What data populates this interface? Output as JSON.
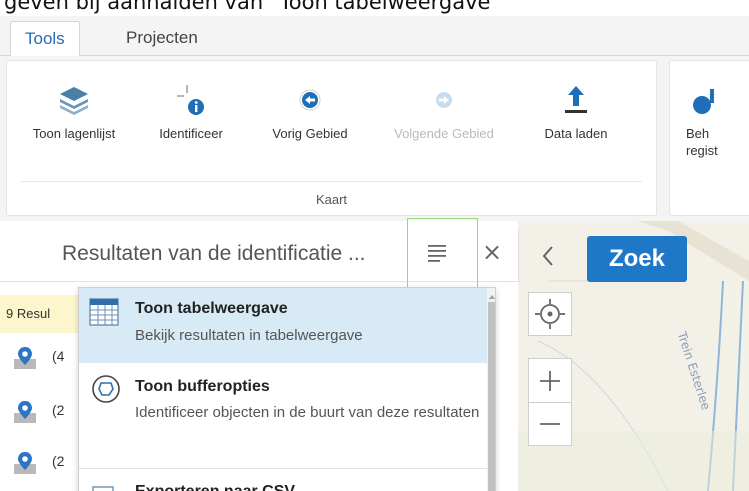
{
  "caption": "geven bij aanhalden van \"Toon tabelweergave\"",
  "tabs": [
    {
      "label": "Tools"
    },
    {
      "label": "Projecten"
    }
  ],
  "ribbon": {
    "group_label": "Kaart",
    "buttons": [
      {
        "label": "Toon lagenlijst",
        "icon": "layers-icon"
      },
      {
        "label": "Identificeer",
        "icon": "identify-icon"
      },
      {
        "label": "Vorig Gebied",
        "icon": "previous-extent-icon"
      },
      {
        "label": "Volgende Gebied",
        "icon": "next-extent-icon"
      },
      {
        "label": "Data laden",
        "icon": "upload-icon"
      }
    ],
    "partial_button": {
      "line1": "Beh",
      "line2": "regist"
    }
  },
  "panel": {
    "title": "Resultaten van de identificatie ...",
    "close": "×",
    "collapse": "<"
  },
  "search_button": "Zoek",
  "map_street_label": "Trein Esterlee",
  "results": {
    "count_label": "9 Resul",
    "items": [
      {
        "count": "(4"
      },
      {
        "count": "(2"
      },
      {
        "count": "(2"
      }
    ]
  },
  "dropdown": {
    "items": [
      {
        "title": "Toon tabelweergave",
        "desc": "Bekijk resultaten in tabelweergave",
        "icon": "table-icon"
      },
      {
        "title": "Toon bufferopties",
        "desc": "Identificeer objecten in de buurt van deze resultaten",
        "icon": "buffer-icon"
      },
      {
        "title": "Exporteren naar CSV",
        "desc": "",
        "icon": "export-icon"
      }
    ]
  },
  "colors": {
    "accent": "#1f77c7",
    "highlight": "#d9eaf7",
    "focus_outline": "#9bd67d",
    "results_bar": "#fdf6cd"
  }
}
